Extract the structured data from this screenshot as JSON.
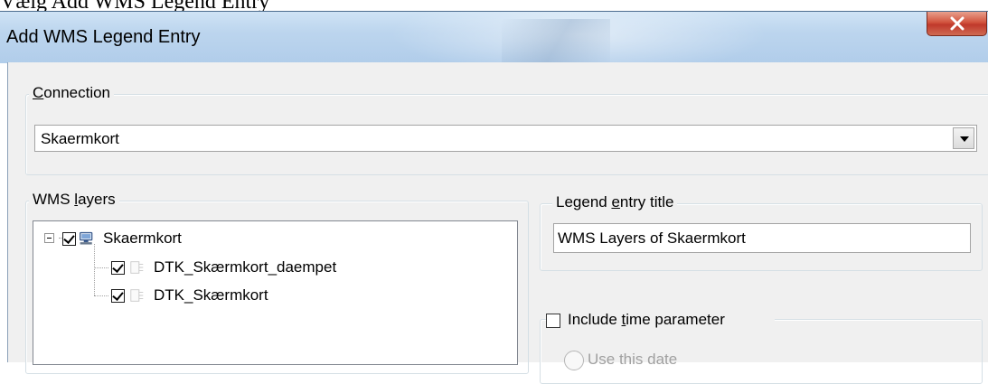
{
  "caption": "Vælg Add WMS Legend Entry",
  "window": {
    "title": "Add WMS Legend Entry",
    "close_label": "x"
  },
  "connection": {
    "legend_mnemonic": "C",
    "legend_rest": "onnection",
    "selected": "Skaermkort"
  },
  "wms_layers": {
    "legend_before": "WMS ",
    "legend_mnemonic": "l",
    "legend_after": "ayers",
    "root": {
      "label": "Skaermkort",
      "checked": true,
      "expanded": true,
      "icon": "server-icon"
    },
    "children": [
      {
        "label": "DTK_Skærmkort_daempet",
        "checked": true,
        "icon": "layer-icon"
      },
      {
        "label": "DTK_Skærmkort",
        "checked": true,
        "icon": "layer-icon"
      }
    ]
  },
  "legend_entry": {
    "legend_before": "Legend ",
    "legend_mnemonic": "e",
    "legend_after": "ntry title",
    "value": "WMS Layers of Skaermkort"
  },
  "time_parameter": {
    "label_before": "Include ",
    "label_mnemonic": "t",
    "label_after": "ime parameter",
    "checked": false,
    "partial_option": "Use this date"
  },
  "colors": {
    "titlebar": "#bcd5ee",
    "dialog_bg": "#f0f0f0",
    "close_button": "#c0392b"
  }
}
